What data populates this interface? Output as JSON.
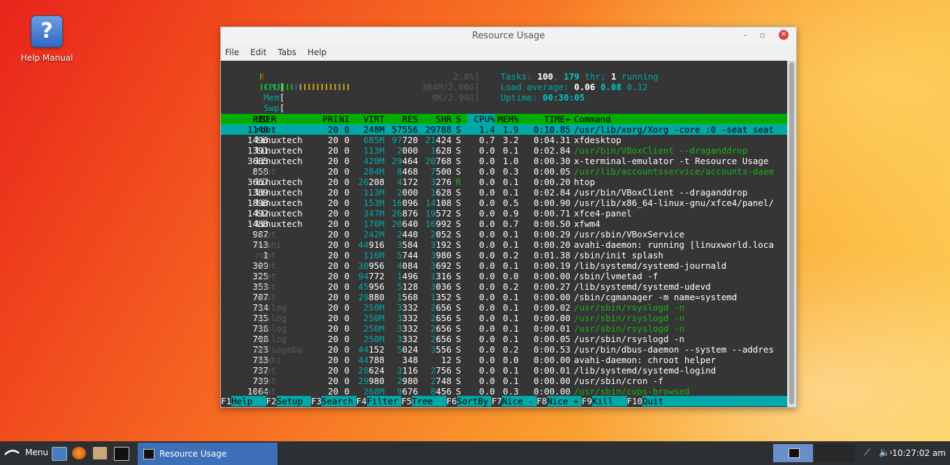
{
  "desktop": {
    "icon_label": "Help Manual"
  },
  "window": {
    "title": "Resource Usage",
    "menu": [
      "File",
      "Edit",
      "Tabs",
      "Help"
    ]
  },
  "htop": {
    "meters": [
      {
        "label": "CPU",
        "value": "2.0%]"
      },
      {
        "label": "Mem",
        "value": "384M/2.00G]"
      },
      {
        "label": "Swp",
        "value": "0K/2.94G]"
      }
    ],
    "tasks": {
      "label": "Tasks: ",
      "count": "100",
      "sep": ", ",
      "threads": "179",
      "thr": " thr; ",
      "running": "1",
      "running_label": " running"
    },
    "load": {
      "label": "Load average: ",
      "one": "0.06",
      "five": "0.08",
      "fifteen": "0.12"
    },
    "uptime": {
      "label": "Uptime: ",
      "value": "00:30:05"
    },
    "columns": [
      "PID",
      "USER",
      "PRI",
      "NI",
      "VIRT",
      "RES",
      "SHR",
      "S",
      "CPU%",
      "MEM%",
      "TIME+",
      "Command"
    ],
    "processes": [
      {
        "pid": "1148",
        "user": "root",
        "pri": "20",
        "ni": "0",
        "virt": "248M",
        "res": "57556",
        "shr": "29788",
        "s": "S",
        "cpu": "1.4",
        "mem": "1.9",
        "time": "0:10.85",
        "cmd": "/usr/lib/xorg/Xorg -core :0 -seat seat"
      },
      {
        "pid": "1496",
        "user": "linuxtech",
        "pri": "20",
        "ni": "0",
        "virt": "685M",
        "res": "97720",
        "shr": "21424",
        "s": "S",
        "cpu": "0.7",
        "mem": "3.2",
        "time": "0:04.31",
        "cmd": "xfdesktop"
      },
      {
        "pid": "1391",
        "user": "linuxtech",
        "pri": "20",
        "ni": "0",
        "virt": "113M",
        "res": "2000",
        "shr": "1628",
        "s": "S",
        "cpu": "0.0",
        "mem": "0.1",
        "time": "0:02.84",
        "cmd": "/usr/bin/VBoxClient --draganddrop"
      },
      {
        "pid": "3665",
        "user": "linuxtech",
        "pri": "20",
        "ni": "0",
        "virt": "420M",
        "res": "29464",
        "shr": "20768",
        "s": "S",
        "cpu": "0.0",
        "mem": "1.0",
        "time": "0:00.30",
        "cmd": "x-terminal-emulator -t Resource Usage"
      },
      {
        "pid": "858",
        "user": "root",
        "pri": "20",
        "ni": "0",
        "virt": "284M",
        "res": "8468",
        "shr": "7500",
        "s": "S",
        "cpu": "0.0",
        "mem": "0.3",
        "time": "0:00.05",
        "cmd": "/usr/lib/accountsservice/accounts-daem"
      },
      {
        "pid": "3667",
        "user": "linuxtech",
        "pri": "20",
        "ni": "0",
        "virt": "26208",
        "res": "4172",
        "shr": "3276",
        "s": "R",
        "cpu": "0.0",
        "mem": "0.1",
        "time": "0:00.20",
        "cmd": "htop"
      },
      {
        "pid": "1389",
        "user": "linuxtech",
        "pri": "20",
        "ni": "0",
        "virt": "113M",
        "res": "2000",
        "shr": "1628",
        "s": "S",
        "cpu": "0.0",
        "mem": "0.1",
        "time": "0:02.84",
        "cmd": "/usr/bin/VBoxClient --draganddrop"
      },
      {
        "pid": "1898",
        "user": "linuxtech",
        "pri": "20",
        "ni": "0",
        "virt": "153M",
        "res": "16096",
        "shr": "14108",
        "s": "S",
        "cpu": "0.0",
        "mem": "0.5",
        "time": "0:00.90",
        "cmd": "/usr/lib/x86_64-linux-gnu/xfce4/panel/"
      },
      {
        "pid": "1492",
        "user": "linuxtech",
        "pri": "20",
        "ni": "0",
        "virt": "347M",
        "res": "26876",
        "shr": "19572",
        "s": "S",
        "cpu": "0.0",
        "mem": "0.9",
        "time": "0:00.71",
        "cmd": "xfce4-panel"
      },
      {
        "pid": "1488",
        "user": "linuxtech",
        "pri": "20",
        "ni": "0",
        "virt": "170M",
        "res": "20640",
        "shr": "16992",
        "s": "S",
        "cpu": "0.0",
        "mem": "0.7",
        "time": "0:00.50",
        "cmd": "xfwm4"
      },
      {
        "pid": "987",
        "user": "root",
        "pri": "20",
        "ni": "0",
        "virt": "242M",
        "res": "2440",
        "shr": "2052",
        "s": "S",
        "cpu": "0.0",
        "mem": "0.1",
        "time": "0:00.29",
        "cmd": "/usr/sbin/VBoxService"
      },
      {
        "pid": "713",
        "user": "avahi",
        "pri": "20",
        "ni": "0",
        "virt": "44916",
        "res": "3584",
        "shr": "3192",
        "s": "S",
        "cpu": "0.0",
        "mem": "0.1",
        "time": "0:00.20",
        "cmd": "avahi-daemon: running [linuxworld.loca"
      },
      {
        "pid": "1",
        "user": "root",
        "pri": "20",
        "ni": "0",
        "virt": "116M",
        "res": "5744",
        "shr": "3980",
        "s": "S",
        "cpu": "0.0",
        "mem": "0.2",
        "time": "0:01.38",
        "cmd": "/sbin/init splash"
      },
      {
        "pid": "309",
        "user": "root",
        "pri": "20",
        "ni": "0",
        "virt": "30956",
        "res": "4084",
        "shr": "3692",
        "s": "S",
        "cpu": "0.0",
        "mem": "0.1",
        "time": "0:00.19",
        "cmd": "/lib/systemd/systemd-journald"
      },
      {
        "pid": "325",
        "user": "root",
        "pri": "20",
        "ni": "0",
        "virt": "94772",
        "res": "1496",
        "shr": "1316",
        "s": "S",
        "cpu": "0.0",
        "mem": "0.0",
        "time": "0:00.00",
        "cmd": "/sbin/lvmetad -f"
      },
      {
        "pid": "353",
        "user": "root",
        "pri": "20",
        "ni": "0",
        "virt": "45956",
        "res": "5128",
        "shr": "3036",
        "s": "S",
        "cpu": "0.0",
        "mem": "0.2",
        "time": "0:00.27",
        "cmd": "/lib/systemd/systemd-udevd"
      },
      {
        "pid": "707",
        "user": "root",
        "pri": "20",
        "ni": "0",
        "virt": "29880",
        "res": "1568",
        "shr": "1352",
        "s": "S",
        "cpu": "0.0",
        "mem": "0.1",
        "time": "0:00.00",
        "cmd": "/sbin/cgmanager -m name=systemd"
      },
      {
        "pid": "734",
        "user": "syslog",
        "pri": "20",
        "ni": "0",
        "virt": "250M",
        "res": "3332",
        "shr": "2656",
        "s": "S",
        "cpu": "0.0",
        "mem": "0.1",
        "time": "0:00.02",
        "cmd": "/usr/sbin/rsyslogd -n"
      },
      {
        "pid": "735",
        "user": "syslog",
        "pri": "20",
        "ni": "0",
        "virt": "250M",
        "res": "3332",
        "shr": "2656",
        "s": "S",
        "cpu": "0.0",
        "mem": "0.1",
        "time": "0:00.00",
        "cmd": "/usr/sbin/rsyslogd -n"
      },
      {
        "pid": "736",
        "user": "syslog",
        "pri": "20",
        "ni": "0",
        "virt": "250M",
        "res": "3332",
        "shr": "2656",
        "s": "S",
        "cpu": "0.0",
        "mem": "0.1",
        "time": "0:00.01",
        "cmd": "/usr/sbin/rsyslogd -n"
      },
      {
        "pid": "708",
        "user": "syslog",
        "pri": "20",
        "ni": "0",
        "virt": "250M",
        "res": "3332",
        "shr": "2656",
        "s": "S",
        "cpu": "0.0",
        "mem": "0.1",
        "time": "0:00.05",
        "cmd": "/usr/sbin/rsyslogd -n"
      },
      {
        "pid": "723",
        "user": "messagebu",
        "pri": "20",
        "ni": "0",
        "virt": "44152",
        "res": "5024",
        "shr": "3556",
        "s": "S",
        "cpu": "0.0",
        "mem": "0.2",
        "time": "0:00.53",
        "cmd": "/usr/bin/dbus-daemon --system --addres"
      },
      {
        "pid": "733",
        "user": "avahi",
        "pri": "20",
        "ni": "0",
        "virt": "44788",
        "res": "348",
        "shr": "12",
        "s": "S",
        "cpu": "0.0",
        "mem": "0.0",
        "time": "0:00.00",
        "cmd": "avahi-daemon: chroot helper"
      },
      {
        "pid": "737",
        "user": "root",
        "pri": "20",
        "ni": "0",
        "virt": "28624",
        "res": "3116",
        "shr": "2756",
        "s": "S",
        "cpu": "0.0",
        "mem": "0.1",
        "time": "0:00.01",
        "cmd": "/lib/systemd/systemd-logind"
      },
      {
        "pid": "739",
        "user": "root",
        "pri": "20",
        "ni": "0",
        "virt": "29980",
        "res": "2980",
        "shr": "2748",
        "s": "S",
        "cpu": "0.0",
        "mem": "0.1",
        "time": "0:00.00",
        "cmd": "/usr/sbin/cron -f"
      },
      {
        "pid": "1064",
        "user": "root",
        "pri": "20",
        "ni": "0",
        "virt": "268M",
        "res": "9676",
        "shr": "8456",
        "s": "S",
        "cpu": "0.0",
        "mem": "0.3",
        "time": "0:00.00",
        "cmd": "/usr/sbin/cups-browsed"
      }
    ],
    "fkeys": [
      {
        "key": "F1",
        "label": "Help  "
      },
      {
        "key": "F2",
        "label": "Setup "
      },
      {
        "key": "F3",
        "label": "Search"
      },
      {
        "key": "F4",
        "label": "Filter"
      },
      {
        "key": "F5",
        "label": "Tree  "
      },
      {
        "key": "F6",
        "label": "SortBy"
      },
      {
        "key": "F7",
        "label": "Nice -"
      },
      {
        "key": "F8",
        "label": "Nice +"
      },
      {
        "key": "F9",
        "label": "Kill  "
      },
      {
        "key": "F10",
        "label": "Quit"
      }
    ]
  },
  "taskbar": {
    "menu_label": "Menu",
    "task_label": "Resource Usage",
    "clock": "10:27:02 am"
  },
  "colors": {
    "term_bg": "#353535",
    "header_green": "#00ad00",
    "cyan": "#00a8a8",
    "taskbar": "#2d3033",
    "active_task": "#3d6fb8"
  }
}
